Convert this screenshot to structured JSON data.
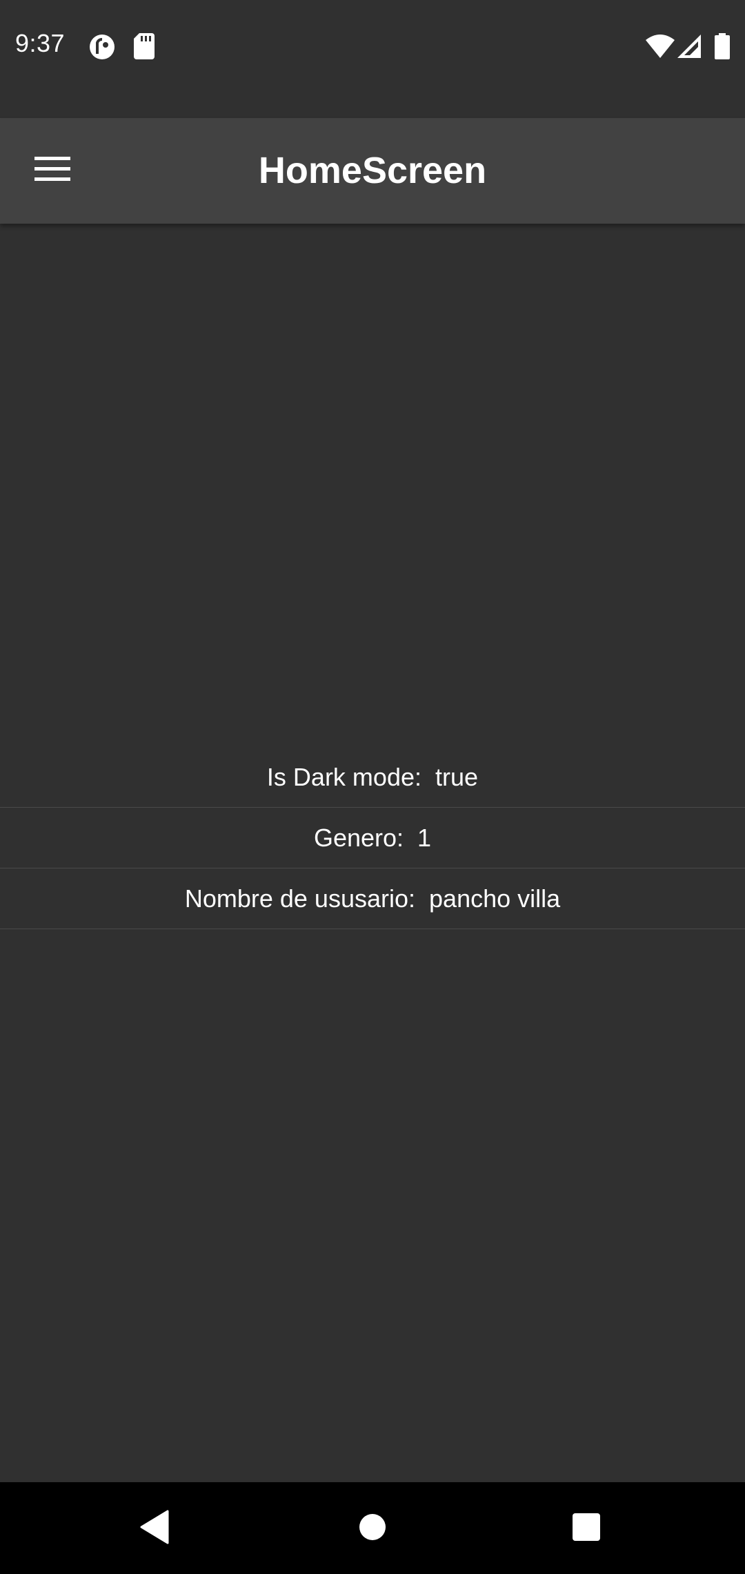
{
  "status_bar": {
    "time": "9:37",
    "left_icons": [
      "pocketcasts-icon",
      "sd-card-icon"
    ],
    "right_icons": [
      "wifi-icon",
      "cellular-signal-icon",
      "battery-icon"
    ]
  },
  "app_bar": {
    "title": "HomeScreen",
    "menu_icon": "hamburger-menu-icon",
    "background": "#424242"
  },
  "info_rows": [
    {
      "label": "Is Dark mode:",
      "value": "true"
    },
    {
      "label": "Genero:",
      "value": "1"
    },
    {
      "label": "Nombre de ususario:",
      "value": "pancho villa"
    }
  ],
  "nav_bar": {
    "buttons": [
      "back-icon",
      "home-icon",
      "recents-icon"
    ]
  },
  "colors": {
    "background": "#303030",
    "app_bar": "#424242",
    "nav_bar": "#000000",
    "text": "#ffffff",
    "divider": "#4a4a4a"
  }
}
